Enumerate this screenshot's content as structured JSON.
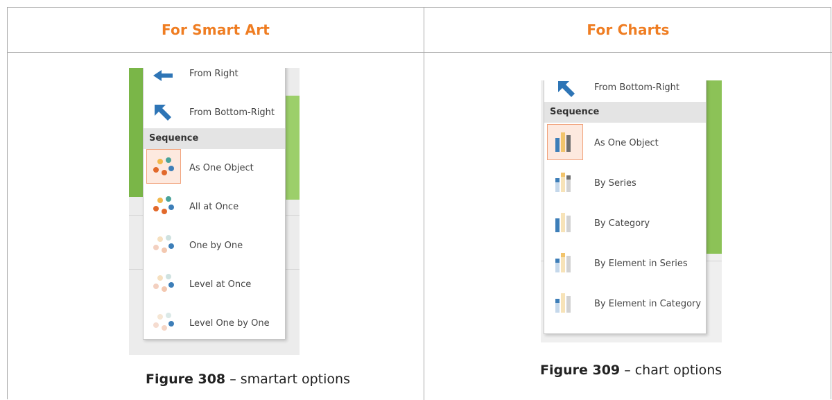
{
  "headers": {
    "left": "For Smart Art",
    "right": "For Charts"
  },
  "smartart": {
    "items_top": [
      {
        "label": "From Right",
        "icon": "arrow-left-icon"
      },
      {
        "label": "From Bottom-Right",
        "icon": "arrow-up-left-icon"
      }
    ],
    "section": "Sequence",
    "items": [
      {
        "label": "As One Object",
        "icon": "dots-icon",
        "selected": true
      },
      {
        "label": "All at Once",
        "icon": "dots-icon"
      },
      {
        "label": "One by One",
        "icon": "dots-faded-icon"
      },
      {
        "label": "Level at Once",
        "icon": "dots-faded-icon"
      },
      {
        "label": "Level One by One",
        "icon": "dots-faded-icon"
      }
    ],
    "caption_bold": "Figure 308",
    "caption_rest": " – smartart options"
  },
  "charts": {
    "items_top": [
      {
        "label": "From Bottom-Right",
        "icon": "arrow-up-left-icon"
      }
    ],
    "section": "Sequence",
    "items": [
      {
        "label": "As One Object",
        "icon": "bars-icon",
        "selected": true
      },
      {
        "label": "By Series",
        "icon": "bars-series-icon"
      },
      {
        "label": "By Category",
        "icon": "bars-category-icon"
      },
      {
        "label": "By Element in Series",
        "icon": "bars-element-series-icon"
      },
      {
        "label": "By Element in Category",
        "icon": "bars-element-category-icon"
      }
    ],
    "caption_bold": "Figure 309",
    "caption_rest": " – chart options"
  },
  "colors": {
    "accent": "#ef7d22",
    "green": "#7ab648",
    "selected_bg": "#fde9df",
    "arrow_blue": "#2e75b6"
  }
}
